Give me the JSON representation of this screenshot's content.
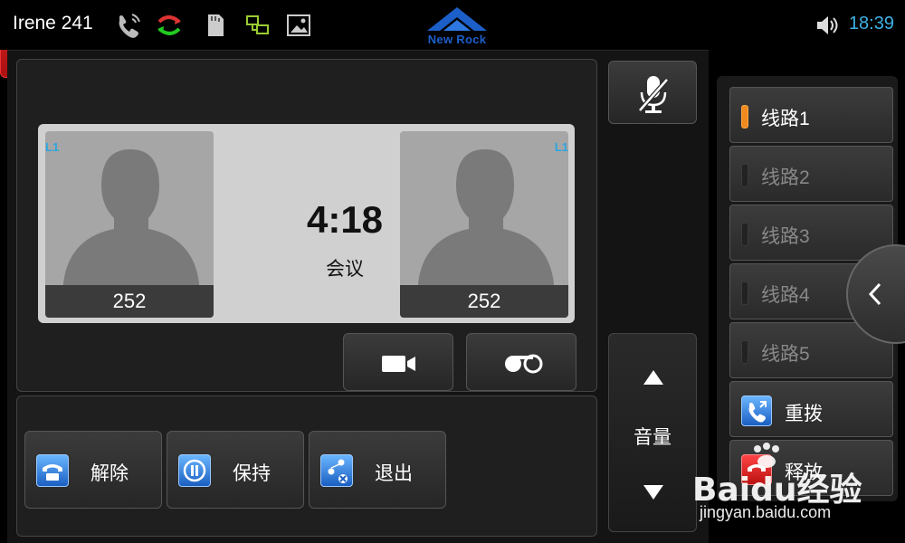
{
  "status_bar": {
    "user": "Irene  241",
    "time": "18:39",
    "icons": [
      "phone-icon",
      "sync-icon",
      "sd-card-icon",
      "network-icon",
      "image-icon",
      "volume-icon"
    ]
  },
  "logo": {
    "text": "New Rock",
    "color": "#1d5fc9"
  },
  "conference": {
    "timer": "4:18",
    "label": "会议",
    "participants": [
      {
        "name": "252",
        "line_tag": "L1"
      },
      {
        "name": "252",
        "line_tag": "L1"
      }
    ]
  },
  "actions": {
    "release_label": "解除",
    "hold_label": "保持",
    "exit_label": "退出"
  },
  "volume": {
    "label": "音量"
  },
  "lines": {
    "items": [
      {
        "label": "线路1",
        "active": true
      },
      {
        "label": "线路2",
        "active": false
      },
      {
        "label": "线路3",
        "active": false
      },
      {
        "label": "线路4",
        "active": false
      },
      {
        "label": "线路5",
        "active": false
      }
    ],
    "redial_label": "重拨",
    "release_label": "释放"
  },
  "watermark": {
    "text": "Baidu经验",
    "url": "jingyan.baidu.com"
  },
  "colors": {
    "accent": "#3fb1e5",
    "active_line": "#f08a1e",
    "hangup": "#c41a1a"
  }
}
